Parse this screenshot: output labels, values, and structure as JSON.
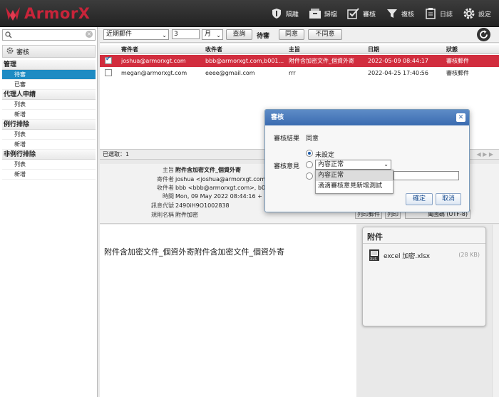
{
  "brand": {
    "name": "ArmorX",
    "color": "#c8243a"
  },
  "nav": [
    {
      "icon": "shield-icon",
      "label": "隔離"
    },
    {
      "icon": "archive-icon",
      "label": "歸檔"
    },
    {
      "icon": "check-box-icon",
      "label": "審核"
    },
    {
      "icon": "filter-icon",
      "label": "複核"
    },
    {
      "icon": "clipboard-icon",
      "label": "日誌"
    },
    {
      "icon": "gear-icon",
      "label": "設定"
    }
  ],
  "sidebar": {
    "search_placeholder": "",
    "title": "審核",
    "groups": [
      {
        "label": "管理",
        "items": [
          "待審",
          "已審"
        ]
      },
      {
        "label": "代理人申請",
        "items": [
          "列表",
          "新增"
        ]
      },
      {
        "label": "例行排除",
        "items": [
          "列表",
          "新增"
        ]
      },
      {
        "label": "非例行排除",
        "items": [
          "列表",
          "新增"
        ]
      }
    ]
  },
  "toolbar": {
    "range": "近期郵件",
    "count": "3",
    "unit": "月",
    "query": "查詢",
    "pending": "待審",
    "agree": "同意",
    "disagree": "不同意"
  },
  "grid": {
    "columns": [
      "寄件者",
      "收件者",
      "主旨",
      "日期",
      "狀態"
    ],
    "rows": [
      {
        "checked": true,
        "from": "joshua@armorxgt.com",
        "to": "bbb@armorxgt.com,b001...",
        "subject": "附件含加密文件_個資外寄",
        "date": "2022-05-09 08:44:17",
        "status": "審核郵件"
      },
      {
        "checked": false,
        "from": "megan@armorxgt.com",
        "to": "eeee@gmail.com",
        "subject": "rrr",
        "date": "2022-04-25 17:40:56",
        "status": "審核郵件"
      }
    ],
    "footer": "已選取：1"
  },
  "preview": {
    "fields": [
      {
        "k": "主旨",
        "v": "附件含加密文件_個資外寄",
        "bold": true
      },
      {
        "k": "寄件者",
        "v": "joshua <joshua@armorxgt.com",
        "bold": false
      },
      {
        "k": "收件者",
        "v": "bbb <bbb@armorxgt.com>, b0",
        "bold": false
      },
      {
        "k": "時間",
        "v": "Mon, 09 May 2022 08:44:16 +",
        "bold": false
      },
      {
        "k": "訊息代號",
        "v": "2490iH9O1002838",
        "bold": false
      },
      {
        "k": "規則名稱",
        "v": "附件加密",
        "bold": false
      }
    ],
    "buttons": [
      "列印郵件",
      "列印"
    ],
    "encoding": "萬國碼 (UTF-8)",
    "body": "附件含加密文件_個資外寄附件含加密文件_個資外寄",
    "attachments_title": "附件",
    "attachment": {
      "name": "excel 加密.xlsx",
      "size": "(28 KB)"
    }
  },
  "dialog": {
    "title": "審核",
    "result_label": "審核結果",
    "result_value": "同意",
    "opinion_label": "審核意見",
    "option_unset": "未設定",
    "select_value": "內容正常",
    "dropdown": [
      "內容正常",
      "滴滴審核意見新增測試"
    ],
    "ok": "確定",
    "cancel": "取消"
  },
  "colors": {
    "accent": "#1e8bc3",
    "selected_row": "#d12d3e",
    "dialog_title": "#3a6bb0"
  }
}
